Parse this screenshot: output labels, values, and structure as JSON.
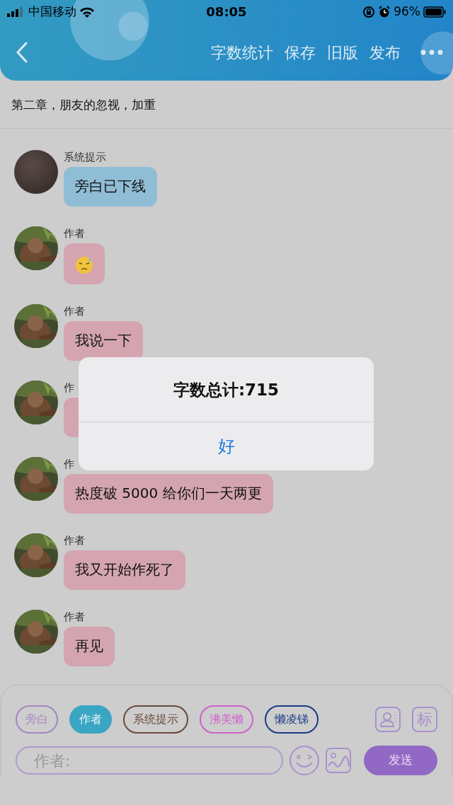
{
  "status_bar": {
    "carrier": "中国移动",
    "time": "08:05",
    "battery": "96%"
  },
  "header": {
    "actions": [
      "字数统计",
      "保存",
      "旧版",
      "发布"
    ]
  },
  "chapter_title": "第二章，朋友的忽视，加重",
  "messages": [
    {
      "sender": "系统提示",
      "text": "旁白已下线",
      "kind": "narration"
    },
    {
      "sender": "作者",
      "kind": "emoji"
    },
    {
      "sender": "作者",
      "text": "我说一下",
      "kind": "author"
    },
    {
      "sender": "作",
      "kind": "author"
    },
    {
      "sender": "作",
      "text": "热度破 5000 给你们一天两更",
      "kind": "author"
    },
    {
      "sender": "作者",
      "text": "我又开始作死了",
      "kind": "author"
    },
    {
      "sender": "作者",
      "text": "再见",
      "kind": "author"
    }
  ],
  "role_chips": [
    {
      "label": "旁白",
      "color": "#a285c4",
      "selected": false
    },
    {
      "label": "作者",
      "color": "#3aa6c4",
      "selected": true
    },
    {
      "label": "系统提示",
      "color": "#6a4a3c",
      "selected": false
    },
    {
      "label": "沸美懒",
      "color": "#d060cc",
      "selected": false
    },
    {
      "label": "懒凌锑",
      "color": "#1c3a86",
      "selected": false
    }
  ],
  "tag_button": "标",
  "composer": {
    "placeholder": "作者:",
    "send": "发送"
  },
  "alert": {
    "title": "字数总计:715",
    "button": "好"
  }
}
